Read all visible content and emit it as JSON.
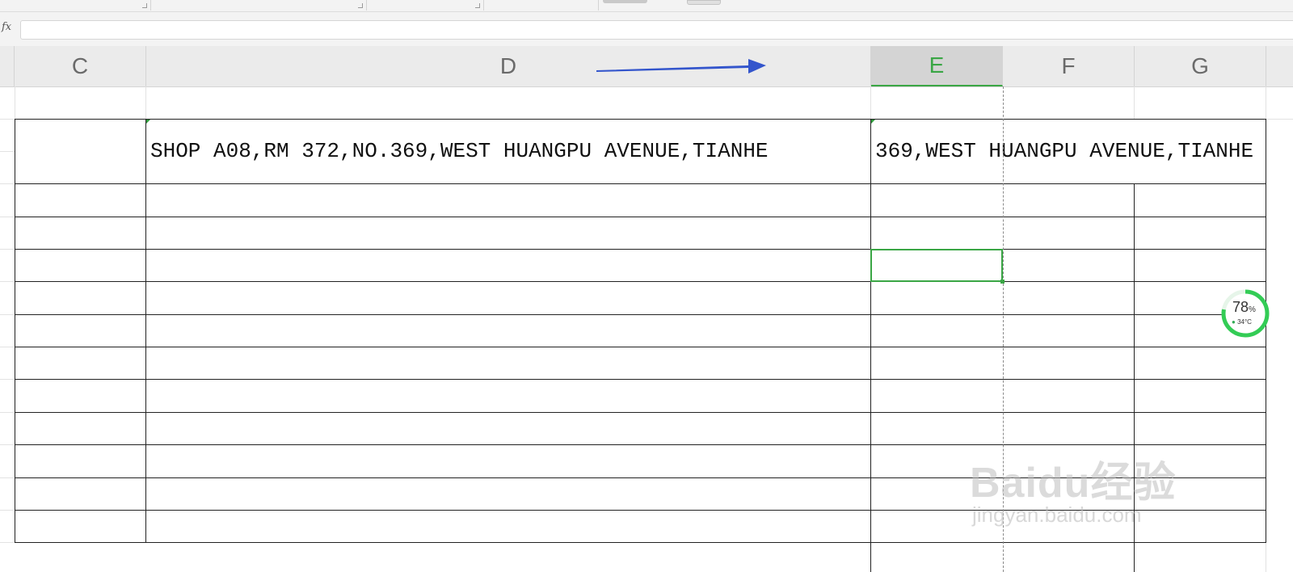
{
  "formula_bar": {
    "fx_label": "fx",
    "value": ""
  },
  "columns": [
    {
      "key": "C",
      "label": "C",
      "selected": false
    },
    {
      "key": "D",
      "label": "D",
      "selected": false
    },
    {
      "key": "E",
      "label": "E",
      "selected": true
    },
    {
      "key": "F",
      "label": "F",
      "selected": false
    },
    {
      "key": "G",
      "label": "G",
      "selected": false
    }
  ],
  "cells": {
    "d_address": "SHOP A08,RM 372,NO.369,WEST HUANGPU AVENUE,TIANHE",
    "e_address": "369,WEST HUANGPU AVENUE,TIANHE"
  },
  "status_widget": {
    "percent_number": "78",
    "percent_sign": "%",
    "temperature": "34°C"
  },
  "watermark": {
    "logo": "Baidu经验",
    "url": "jingyan.baidu.com"
  },
  "colors": {
    "selection": "#3aa645",
    "arrow": "#3355cc",
    "widget_ring": "#33cc55"
  }
}
